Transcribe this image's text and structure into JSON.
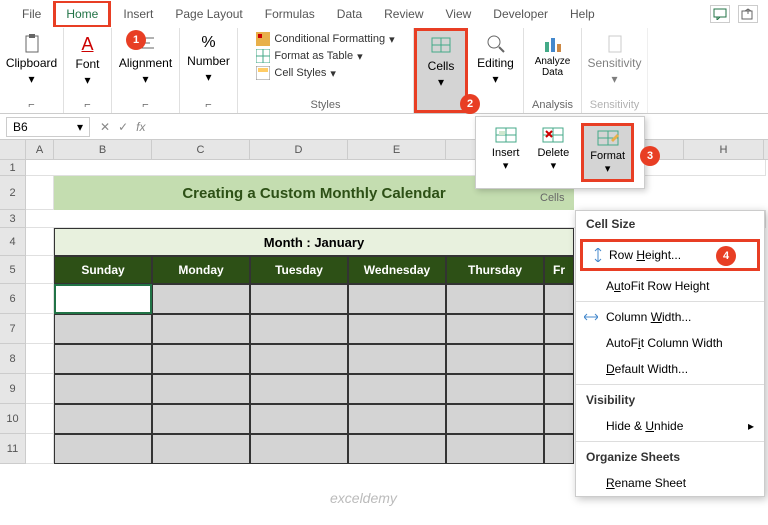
{
  "tabs": [
    "File",
    "Home",
    "Insert",
    "Page Layout",
    "Formulas",
    "Data",
    "Review",
    "View",
    "Developer",
    "Help"
  ],
  "ribbon": {
    "clipboard": "Clipboard",
    "font": "Font",
    "alignment": "Alignment",
    "number": "Number",
    "styles": "Styles",
    "cond_fmt": "Conditional Formatting",
    "fmt_table": "Format as Table",
    "cell_styles": "Cell Styles",
    "cells": "Cells",
    "editing": "Editing",
    "analyze": "Analyze Data",
    "analysis": "Analysis",
    "sensitivity": "Sensitivity"
  },
  "namebox": "B6",
  "fx": "fx",
  "cols": [
    "A",
    "B",
    "C",
    "D",
    "E",
    "H"
  ],
  "row_nums": [
    "1",
    "2",
    "3",
    "4",
    "5",
    "6",
    "7",
    "8",
    "9",
    "10",
    "11"
  ],
  "sheet": {
    "title": "Creating a Custom Monthly Calendar",
    "month": "Month : January",
    "days": [
      "Sunday",
      "Monday",
      "Tuesday",
      "Wednesday",
      "Thursday",
      "Fr"
    ]
  },
  "cells_popup": {
    "insert": "Insert",
    "delete": "Delete",
    "format": "Format",
    "caption": "Cells"
  },
  "menu": {
    "cell_size": "Cell Size",
    "row_height": "Row Height...",
    "autofit_row": "AutoFit Row Height",
    "col_width": "Column Width...",
    "autofit_col": "AutoFit Column Width",
    "default_w": "Default Width...",
    "visibility": "Visibility",
    "hide": "Hide & Unhide",
    "organize": "Organize Sheets",
    "rename": "Rename Sheet"
  },
  "badges": {
    "b1": "1",
    "b2": "2",
    "b3": "3",
    "b4": "4"
  },
  "watermark": "exceldemy"
}
